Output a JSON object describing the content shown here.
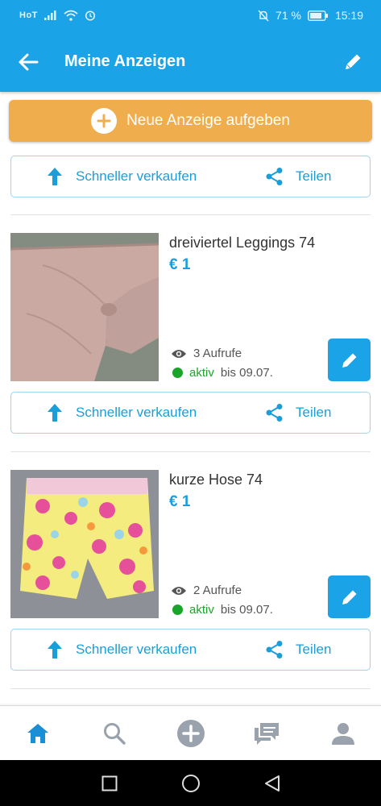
{
  "status_bar": {
    "carrier": "HoT",
    "battery": "71 %",
    "time": "15:19"
  },
  "app_bar": {
    "title": "Meine Anzeigen",
    "back_icon": "arrow-left-icon",
    "edit_icon": "pencil-icon"
  },
  "new_ad": {
    "label": "Neue Anzeige aufgeben"
  },
  "actions": {
    "sell_label": "Schneller verkaufen",
    "share_label": "Teilen"
  },
  "listings": [
    {
      "title": "dreiviertel Leggings 74",
      "price": "€ 1",
      "views": "3 Aufrufe",
      "status": "aktiv",
      "until": "bis 09.07."
    },
    {
      "title": "kurze Hose 74",
      "price": "€ 1",
      "views": "2 Aufrufe",
      "status": "aktiv",
      "until": "bis 09.07."
    }
  ],
  "bottom_nav": [
    {
      "icon": "home-icon",
      "active": true
    },
    {
      "icon": "search-icon",
      "active": false
    },
    {
      "icon": "add-icon",
      "active": false
    },
    {
      "icon": "messages-icon",
      "active": false
    },
    {
      "icon": "profile-icon",
      "active": false
    }
  ],
  "colors": {
    "primary": "#1aa3e6",
    "accent_button": "#f0ad4e",
    "link_blue": "#1a9ed9",
    "active_green": "#1aa52a",
    "nav_active": "#1a8fd6",
    "nav_inactive": "#9aa3ad"
  }
}
